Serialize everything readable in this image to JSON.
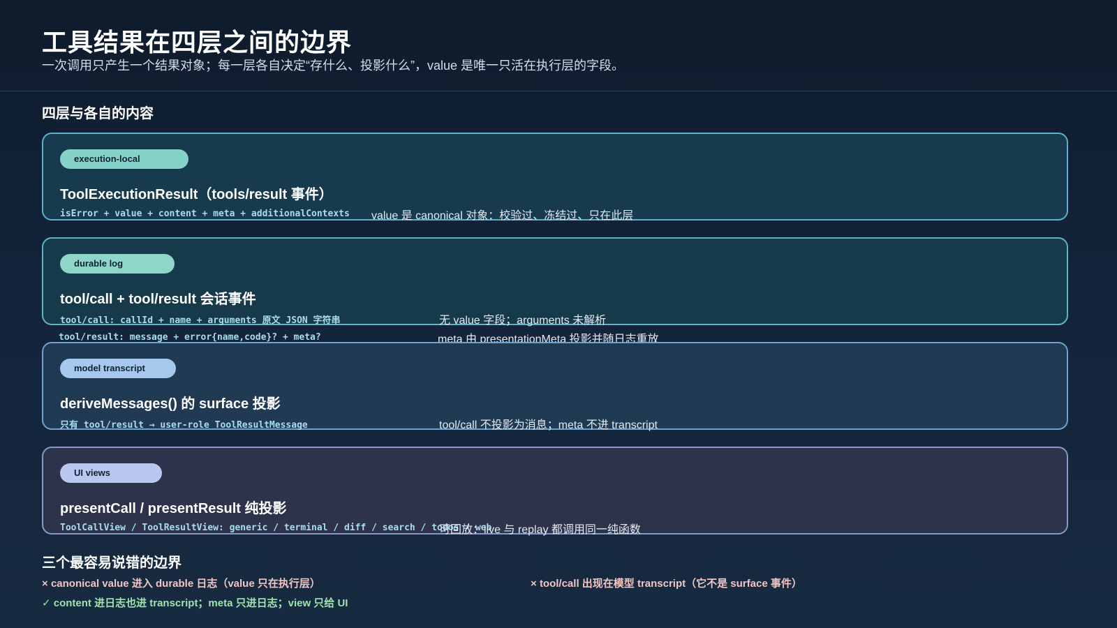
{
  "header": {
    "title": "工具结果在四层之间的边界",
    "subtitle": "一次调用只产生一个结果对象；每一层各自决定“存什么、投影什么”，value 是唯一只活在执行层的字段。"
  },
  "sections": {
    "layers_title": "四层与各自的内容",
    "pitfalls_title": "三个最容易说错的边界"
  },
  "layers": [
    {
      "tag": "execution-local",
      "title": "ToolExecutionResult（tools/result 事件）",
      "rows": [
        {
          "code": "isError + value + content + meta + additionalContexts",
          "note": "value 是 canonical 对象：校验过、冻结过、只在此层"
        }
      ]
    },
    {
      "tag": "durable log",
      "title": "tool/call + tool/result 会话事件",
      "rows": [
        {
          "code": "tool/call: callId + name + arguments 原文 JSON 字符串",
          "note": "无 value 字段；arguments 未解析"
        },
        {
          "code": "tool/result: message + error{name,code}? + meta?",
          "note": "meta 由 presentationMeta 投影并随日志重放"
        }
      ]
    },
    {
      "tag": "model transcript",
      "title": "deriveMessages() 的 surface 投影",
      "rows": [
        {
          "code": "只有 tool/result → user-role ToolResultMessage",
          "note": "tool/call 不投影为消息；meta 不进 transcript"
        }
      ]
    },
    {
      "tag": "UI views",
      "title": "presentCall / presentResult 纯投影",
      "rows": [
        {
          "code": "ToolCallView / ToolResultView: generic / terminal / diff / search / todos / web",
          "note": "可回放：live 与 replay 都调用同一纯函数"
        }
      ]
    }
  ],
  "pitfalls": [
    {
      "mark": "×",
      "text": "canonical value 进入 durable 日志（value 只在执行层）"
    },
    {
      "mark": "×",
      "text": "tool/call 出现在模型 transcript（它不是 surface 事件）"
    },
    {
      "mark": "✓",
      "text": "content 进日志也进 transcript；meta 只进日志；view 只给 UI"
    }
  ],
  "colors": {
    "layer_bg": [
      "#173a4e",
      "#173a4a",
      "#213a54",
      "#2c334a"
    ],
    "pill_bg": [
      "#85d3c8",
      "#8fd5c8",
      "#a5c8ec",
      "#b8c8ee"
    ],
    "layer_border": [
      "#5fb0cc",
      "#5fb5c4",
      "#6fa3cf",
      "#8a98c6"
    ],
    "wrong": "#f2c4c4",
    "right": "#9ee3b0"
  }
}
